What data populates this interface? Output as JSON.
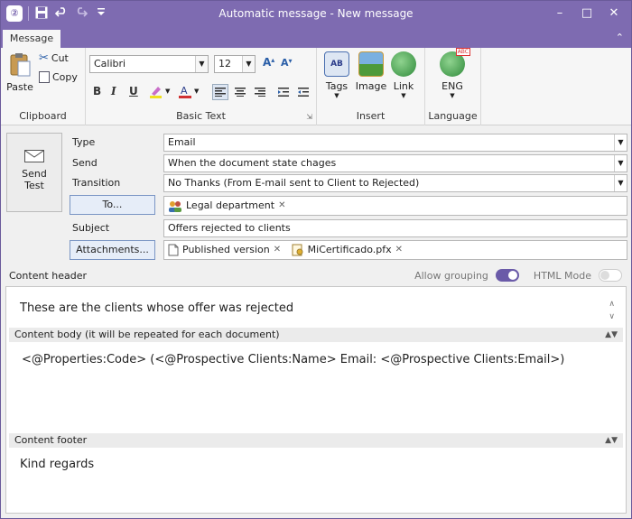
{
  "window": {
    "title": "Automatic message - New message",
    "logo_text": "②",
    "accent_color": "#7e6bb1"
  },
  "qat": {
    "save_icon": "save-icon",
    "undo_icon": "undo-icon",
    "redo_icon": "redo-icon",
    "more_icon": "dropdown-icon"
  },
  "tabs": [
    {
      "label": "Message"
    }
  ],
  "ribbon": {
    "clipboard": {
      "label": "Clipboard",
      "paste": "Paste",
      "cut": "Cut",
      "copy": "Copy"
    },
    "basic_text": {
      "label": "Basic Text",
      "font_name": "Calibri",
      "font_size": "12",
      "grow_glyph": "A",
      "shrink_glyph": "A",
      "bold_glyph": "B",
      "italic_glyph": "I",
      "underline_glyph": "U"
    },
    "insert": {
      "label": "Insert",
      "tags": "Tags",
      "image": "Image",
      "link": "Link"
    },
    "language": {
      "label": "Language",
      "lang": "ENG",
      "lang_badge": "ABC"
    }
  },
  "form": {
    "send_test_line1": "Send",
    "send_test_line2": "Test",
    "type_label": "Type",
    "type_value": "Email",
    "send_label": "Send",
    "send_value": "When the document state chages",
    "transition_label": "Transition",
    "transition_value": "No Thanks (From E-mail sent to Client to Rejected)",
    "to_button": "To...",
    "to_chip": "Legal department",
    "subject_label": "Subject",
    "subject_value": "Offers rejected to clients",
    "attachments_button": "Attachments...",
    "attachments": [
      {
        "name": "Published version"
      },
      {
        "name": "MiCertificado.pfx"
      }
    ]
  },
  "content": {
    "header_label": "Content header",
    "allow_grouping_label": "Allow grouping",
    "allow_grouping_on": true,
    "html_mode_label": "HTML Mode",
    "html_mode_on": false,
    "header_text": "These are the clients whose offer was rejected",
    "body_section_label": "Content body (it will be repeated for each document)",
    "body_text": "<@Properties:Code>  (<@Prospective Clients:Name>  Email: <@Prospective Clients:Email>)",
    "footer_section_label": "Content footer",
    "footer_text": "Kind regards"
  }
}
